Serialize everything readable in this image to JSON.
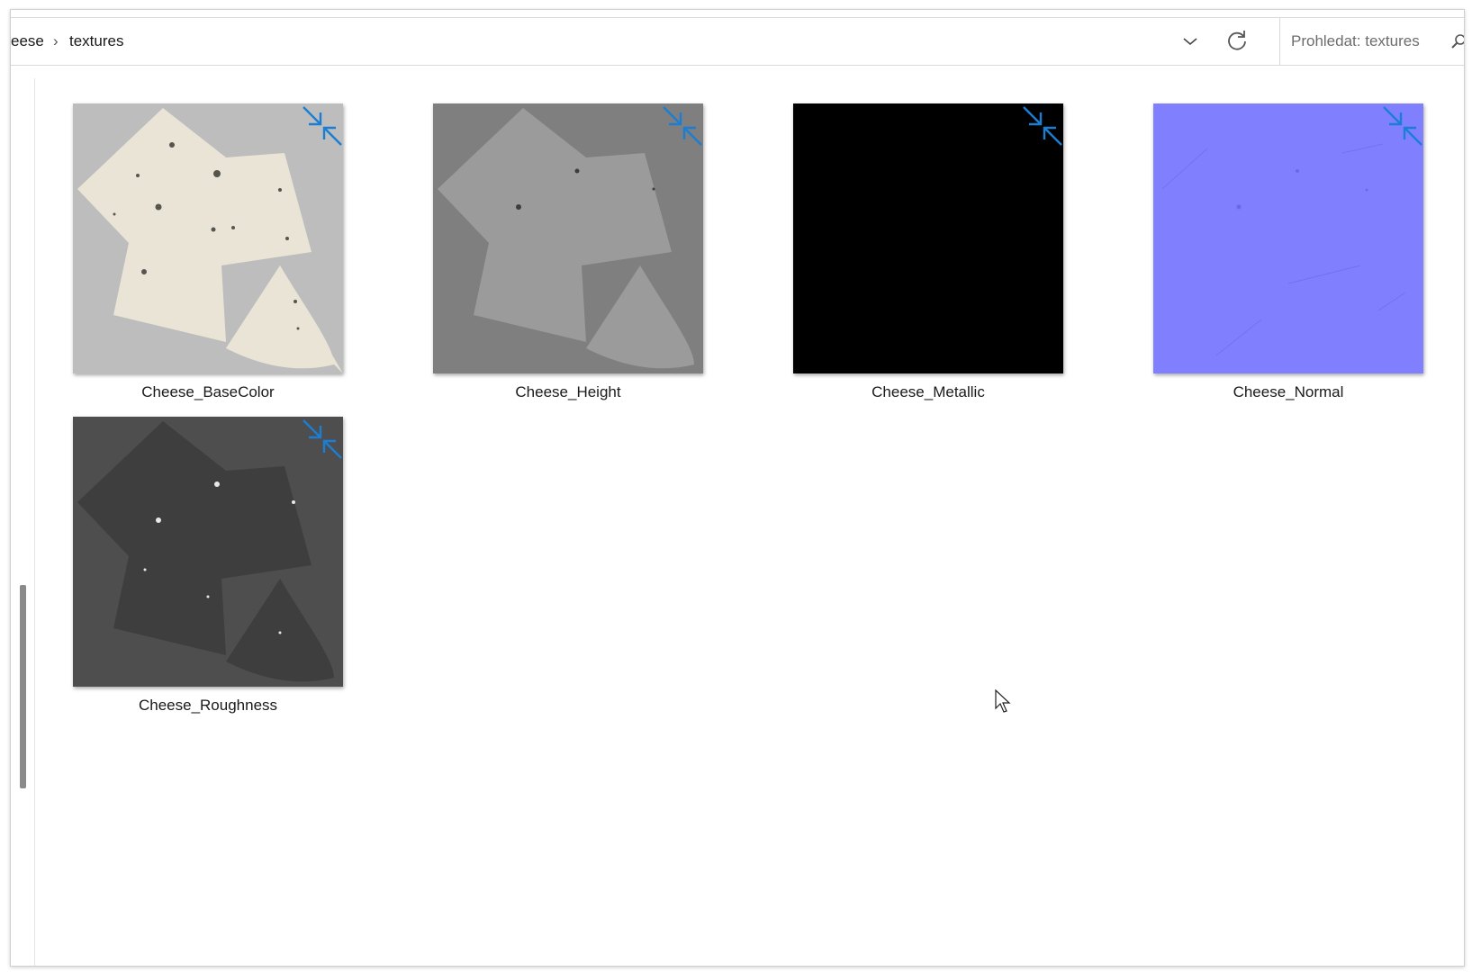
{
  "window": {
    "background": "#ffffff"
  },
  "addressbar": {
    "breadcrumbs": [
      "eese",
      "textures"
    ],
    "separator": "›",
    "dropdown_icon": "chevron-down-icon",
    "refresh_icon": "refresh-icon"
  },
  "search": {
    "placeholder": "Prohledat: textures",
    "icon": "search-icon"
  },
  "files": [
    {
      "name": "Cheese_BaseColor",
      "thumbnail": "basecolor",
      "badge_icon": "compressed-arrows-icon"
    },
    {
      "name": "Cheese_Height",
      "thumbnail": "height",
      "badge_icon": "compressed-arrows-icon"
    },
    {
      "name": "Cheese_Metallic",
      "thumbnail": "metallic",
      "badge_icon": "compressed-arrows-icon"
    },
    {
      "name": "Cheese_Normal",
      "thumbnail": "normal",
      "badge_icon": "compressed-arrows-icon"
    },
    {
      "name": "Cheese_Roughness",
      "thumbnail": "roughness",
      "badge_icon": "compressed-arrows-icon"
    }
  ],
  "colors": {
    "accent_blue": "#1a7fd4",
    "basecolor_bg": "#bdbdbd",
    "basecolor_fg": "#e9e4d6",
    "height_bg": "#7f7f7f",
    "height_fg": "#9b9b9b",
    "metallic_bg": "#000000",
    "normal_bg": "#8080ff",
    "roughness_bg": "#4e4e4e",
    "roughness_fg": "#3e3e3e"
  }
}
